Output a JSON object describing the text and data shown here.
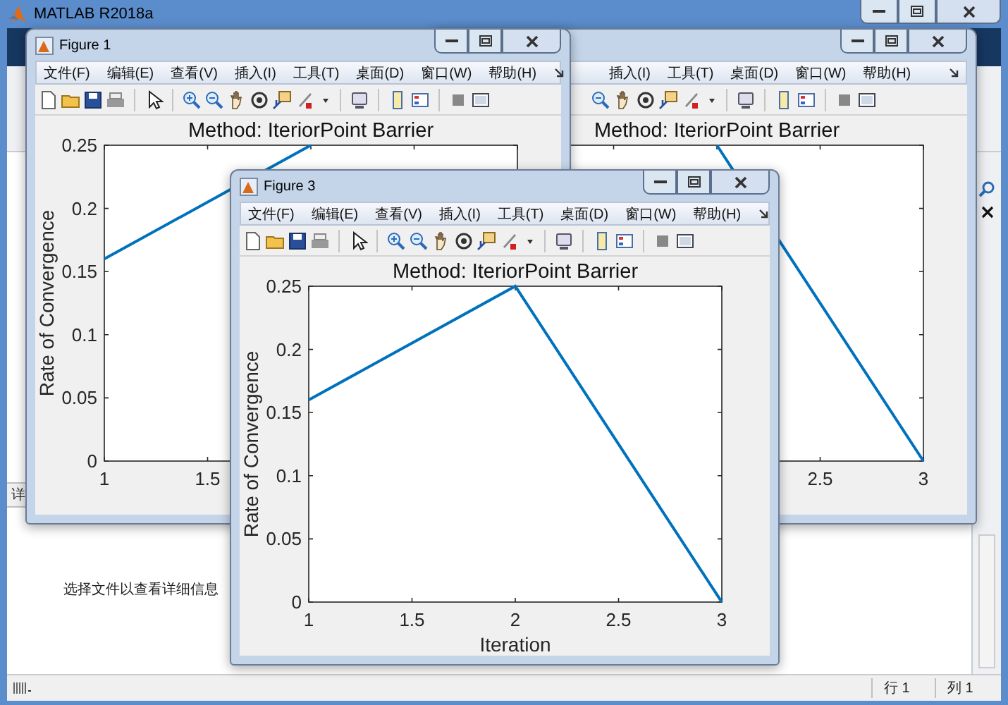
{
  "window": {
    "title": "MATLAB R2018a"
  },
  "side_tab": {
    "label": "详"
  },
  "file_details": {
    "message": "选择文件以查看详细信息"
  },
  "status_bar": {
    "items": [
      "行 1",
      "列 1"
    ]
  },
  "figures": [
    {
      "title": "Figure 1",
      "menus": [
        "文件(F)",
        "编辑(E)",
        "查看(V)",
        "插入(I)",
        "工具(T)",
        "桌面(D)",
        "窗口(W)",
        "帮助(H)"
      ],
      "chart_data": {
        "type": "line",
        "title": "Method: IteriorPoint Barrier",
        "ylabel": "Rate of Convergence",
        "x": [
          1,
          2
        ],
        "series": [
          {
            "color": "#0072bd",
            "values": [
              0.16,
              0.25
            ]
          }
        ],
        "xlim": [
          1,
          3
        ],
        "ylim": [
          0,
          0.25
        ],
        "xticks": [
          1,
          1.5
        ],
        "yticks": [
          0,
          0.05,
          0.1,
          0.15,
          0.2,
          0.25
        ]
      }
    },
    {
      "menus": [
        "插入(I)",
        "工具(T)",
        "桌面(D)",
        "窗口(W)",
        "帮助(H)"
      ],
      "chart_data": {
        "type": "line",
        "title": "Method: IteriorPoint Barrier",
        "x": [
          2,
          3
        ],
        "series": [
          {
            "color": "#0072bd",
            "values": [
              0.25,
              0
            ]
          }
        ],
        "xlim": [
          1,
          3
        ],
        "ylim": [
          0,
          0.25
        ],
        "xticks": [
          2.5,
          3
        ]
      }
    },
    {
      "title": "Figure 3",
      "menus": [
        "文件(F)",
        "编辑(E)",
        "查看(V)",
        "插入(I)",
        "工具(T)",
        "桌面(D)",
        "窗口(W)",
        "帮助(H)"
      ],
      "chart_data": {
        "type": "line",
        "title": "Method: IteriorPoint Barrier",
        "xlabel": "Iteration",
        "ylabel": "Rate of Convergence",
        "x": [
          1,
          2,
          3
        ],
        "series": [
          {
            "color": "#0072bd",
            "values": [
              0.16,
              0.25,
              0
            ]
          }
        ],
        "xlim": [
          1,
          3
        ],
        "ylim": [
          0,
          0.25
        ],
        "xticks": [
          1,
          1.5,
          2,
          2.5,
          3
        ],
        "yticks": [
          0,
          0.05,
          0.1,
          0.15,
          0.2,
          0.25
        ]
      }
    }
  ]
}
